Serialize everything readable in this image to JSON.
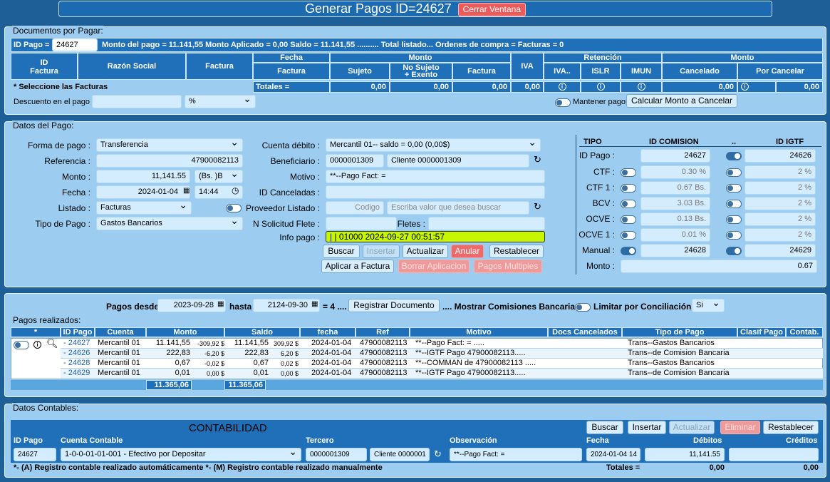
{
  "window": {
    "title": "Generar Pagos ID=24627",
    "close_label": "Cerrar Ventana"
  },
  "docs": {
    "legend": "Documentos por Pagar:",
    "id_pago_label": "ID Pago =",
    "id_pago_value": "24627",
    "summary": "Monto del pago = 11.141,55 Monto Aplicado = 0,00 Saldo = 11.141,55 .......... Total listado... Ordenes de compra = Facturas = 0",
    "headers": {
      "id_factura": "ID\nFactura",
      "razon": "Razón Social",
      "factura": "Factura",
      "fecha": "Fecha",
      "fecha_factura": "Factura",
      "monto": "Monto",
      "sujeto": "Sujeto",
      "no_sujeto": "No Sujeto\n+ Exento",
      "monto_factura": "Factura",
      "iva": "IVA",
      "retencion": "Retención",
      "iva_ret": "IVA..",
      "islr": "ISLR",
      "imun": "IMUN",
      "monto2": "Monto",
      "cancelado": "Cancelado",
      "por_cancelar": "Por Cancelar"
    },
    "select_note": "* Seleccione las Facturas",
    "totals_label": "Totales =",
    "totals": [
      "0,00",
      "0,00",
      "0,00",
      "0,00",
      "0,00",
      "0,00"
    ],
    "descuento_label": "Descuento en el pago",
    "descuento_unit": "%",
    "mantener_label": "Mantener pagos",
    "calcular_label": "Calcular Monto a Cancelar"
  },
  "pago": {
    "legend": "Datos del Pago:",
    "forma_label": "Forma de pago :",
    "forma": "Transferencia",
    "referencia_label": "Referencia :",
    "referencia": "47900082113",
    "monto_label": "Monto :",
    "monto": "11,141.55",
    "moneda": "(Bs. )B",
    "fecha_label": "Fecha :",
    "fecha": "2024-01-04",
    "hora": "14:44",
    "listado_label": "Listado :",
    "listado": "Facturas",
    "tipo_label": "Tipo de Pago :",
    "tipo": "Gastos Bancarios",
    "cuenta_label": "Cuenta débito :",
    "cuenta": "Mercantil 01-- saldo = 0,00 (0,00$)",
    "beneficiario_label": "Beneficiario :",
    "beneficiario_id": "0000001309",
    "beneficiario_name": "Cliente 0000001309",
    "motivo_label": "Motivo :",
    "motivo": "**--Pago Fact: =",
    "canceladas_label": "ID Canceladas :",
    "proveedor_label": "Proveedor Listado :",
    "proveedor_ph": "Codigo",
    "proveedor_search_ph": "Escriba valor que desea buscar",
    "flete_label": "N Solicitud Flete :",
    "fletes_label": "Fletes :",
    "info_label": "Info pago :",
    "info": "| | 01000 2024-09-27 00:51:57",
    "buttons": {
      "buscar": "Buscar",
      "insertar": "Insertar",
      "actualizar": "Actualizar",
      "anular": "Anular",
      "restablecer": "Restablecer",
      "aplicar": "Aplicar a Factura",
      "borrar": "Borrar Aplicacion",
      "multiples": "Pagos Multiples"
    },
    "commission": {
      "headers": {
        "tipo": "TIPO",
        "id_comision": "ID COMISION",
        "dots": "..",
        "id_igtf": "ID IGTF"
      },
      "rows": [
        {
          "label": "ID Pago :",
          "v1": "24627",
          "v2": "24626"
        },
        {
          "label": "CTF :",
          "v1": "0.30 %",
          "v2": "2 %"
        },
        {
          "label": "CTF 1 :",
          "v1": "0.67 Bs.",
          "v2": "2 %"
        },
        {
          "label": "BCV :",
          "v1": "3.03 Bs.",
          "v2": "2 %"
        },
        {
          "label": "OCVE :",
          "v1": "0.13 Bs.",
          "v2": "2 %"
        },
        {
          "label": "OCVE 1 :",
          "v1": "0.01 %",
          "v2": "2 %"
        },
        {
          "label": "Manual :",
          "v1": "24628",
          "v2": "24629"
        }
      ],
      "monto_label": "Monto :",
      "monto": "0.67"
    }
  },
  "pagos": {
    "desde_label": "Pagos desde",
    "desde": "2023-09-28",
    "hasta_label": "hasta",
    "hasta": "2124-09-30",
    "count": "= 4 ....",
    "registrar_label": "Registrar Documento",
    "mostrar_label": ".... Mostrar Comisiones Bancarias :",
    "limitar_label": "Limitar por Conciliación :",
    "limitar": "Si",
    "legend": "Pagos realizados:",
    "headers": [
      "*",
      "ID Pago",
      "Cuenta",
      "Monto",
      "Saldo",
      "fecha",
      "Ref",
      "Motivo",
      "Docs Cancelados",
      "Tipo de Pago",
      "Clasif Pago",
      "Contab."
    ],
    "rows": [
      {
        "id": "- 24627",
        "cuenta": "Mercantil 01",
        "monto": "11.141,55",
        "monto_usd": "-309,92 $",
        "saldo": "11.141,55",
        "saldo_usd": "309,92 $",
        "fecha": "2024-01-04",
        "ref": "47900082113",
        "motivo": "**--Pago Fact: = .....",
        "tipo": "Trans--Gastos Bancarios"
      },
      {
        "id": "- 24626",
        "cuenta": "Mercantil 01",
        "monto": "222,83",
        "monto_usd": "-6,20 $",
        "saldo": "222,83",
        "saldo_usd": "6,20 $",
        "fecha": "2024-01-04",
        "ref": "47900082113",
        "motivo": "**--IGTF Pago 47900082113.....",
        "tipo": "Trans--de Comision Bancaria"
      },
      {
        "id": "- 24628",
        "cuenta": "Mercantil 01",
        "monto": "0,67",
        "monto_usd": "-0,02 $",
        "saldo": "0,67",
        "saldo_usd": "0,02 $",
        "fecha": "2024-01-04",
        "ref": "47900082113",
        "motivo": "**--COMMAN de 47900082113 .....",
        "tipo": "Trans--Gastos Bancarios"
      },
      {
        "id": "- 24629",
        "cuenta": "Mercantil 01",
        "monto": "0,01",
        "monto_usd": "0,00 $",
        "saldo": "0,01",
        "saldo_usd": "0,00 $",
        "fecha": "2024-01-04",
        "ref": "47900082113",
        "motivo": "**--IGTF Pago 47900082113.....",
        "tipo": "Trans--de Comision Bancaria"
      }
    ],
    "total_monto": "11.365,06",
    "total_saldo": "11.365,06"
  },
  "contables": {
    "legend": "Datos Contables:",
    "title": "CONTABILIDAD",
    "buttons": {
      "buscar": "Buscar",
      "insertar": "Insertar",
      "actualizar": "Actualizar",
      "eliminar": "Eliminar",
      "restablecer": "Restablecer"
    },
    "headers": {
      "id_pago": "ID Pago",
      "cuenta": "Cuenta Contable",
      "tercero": "Tercero",
      "observacion": "Observación",
      "fecha": "Fecha",
      "debitos": "Débitos",
      "creditos": "Créditos"
    },
    "row": {
      "id_pago": "24627",
      "cuenta": "1-0-0-01-01-001 - Efectivo por Depositar",
      "tercero_id": "0000001309",
      "tercero_name": "Cliente 0000001",
      "observacion": "**--Pago Fact: =",
      "fecha": "2024-01-04 14",
      "debitos": "11,141.55"
    },
    "note": "*- (A) Registro contable realizado automáticamente *- (M) Registro contable realizado manualmente",
    "totales_label": "Totales =",
    "tot_deb": "0,00",
    "tot_cred": "0,00"
  }
}
